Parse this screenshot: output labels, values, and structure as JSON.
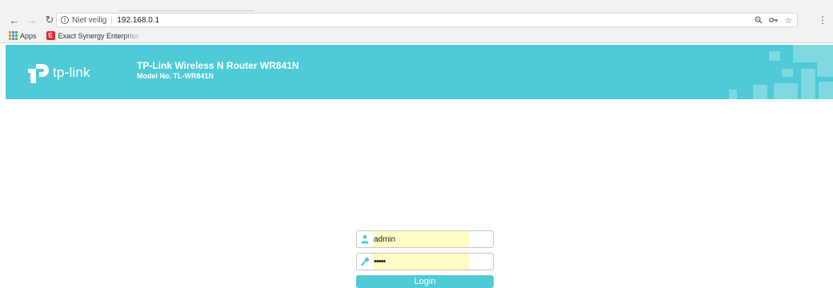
{
  "browser": {
    "security_label": "Niet veilig",
    "url": "192.168.0.1",
    "bookmarks": {
      "apps_label": "Apps",
      "exact_icon_letter": "E",
      "exact_label": "Exact Synergy Enterprise"
    },
    "icons": [
      "back-arrow-icon",
      "forward-arrow-icon",
      "reload-icon",
      "info-icon",
      "zoom-icon",
      "key-icon",
      "star-icon",
      "menu-dots-icon"
    ]
  },
  "router": {
    "brand": "tp-link",
    "title": "TP-Link Wireless N Router WR841N",
    "model": "Model No. TL-WR841N",
    "header_color": "#4ecbd6"
  },
  "login": {
    "username": "admin",
    "password": "admin",
    "button_label": "Login",
    "autofill_color": "#fdfdc4"
  }
}
